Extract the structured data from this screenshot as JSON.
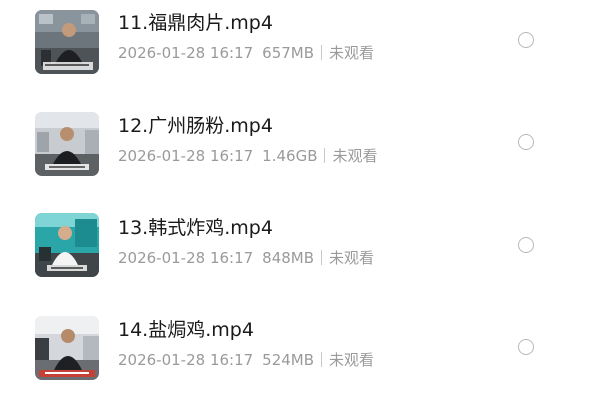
{
  "files": [
    {
      "name": "11.福鼎肉片.mp4",
      "date": "2026-01-28 16:17",
      "size": "657MB",
      "status": "未观看",
      "thumbnail_icon": "video-thumbnail",
      "selected": false
    },
    {
      "name": "12.广州肠粉.mp4",
      "date": "2026-01-28 16:17",
      "size": "1.46GB",
      "status": "未观看",
      "thumbnail_icon": "video-thumbnail",
      "selected": false
    },
    {
      "name": "13.韩式炸鸡.mp4",
      "date": "2026-01-28 16:17",
      "size": "848MB",
      "status": "未观看",
      "thumbnail_icon": "video-thumbnail",
      "selected": false
    },
    {
      "name": "14.盐焗鸡.mp4",
      "date": "2026-01-28 16:17",
      "size": "524MB",
      "status": "未观看",
      "thumbnail_icon": "video-thumbnail",
      "selected": false
    }
  ],
  "colors": {
    "name_text": "#1a1a1a",
    "meta_text": "#9a9a9a",
    "radio_border": "#b8b8b8"
  }
}
